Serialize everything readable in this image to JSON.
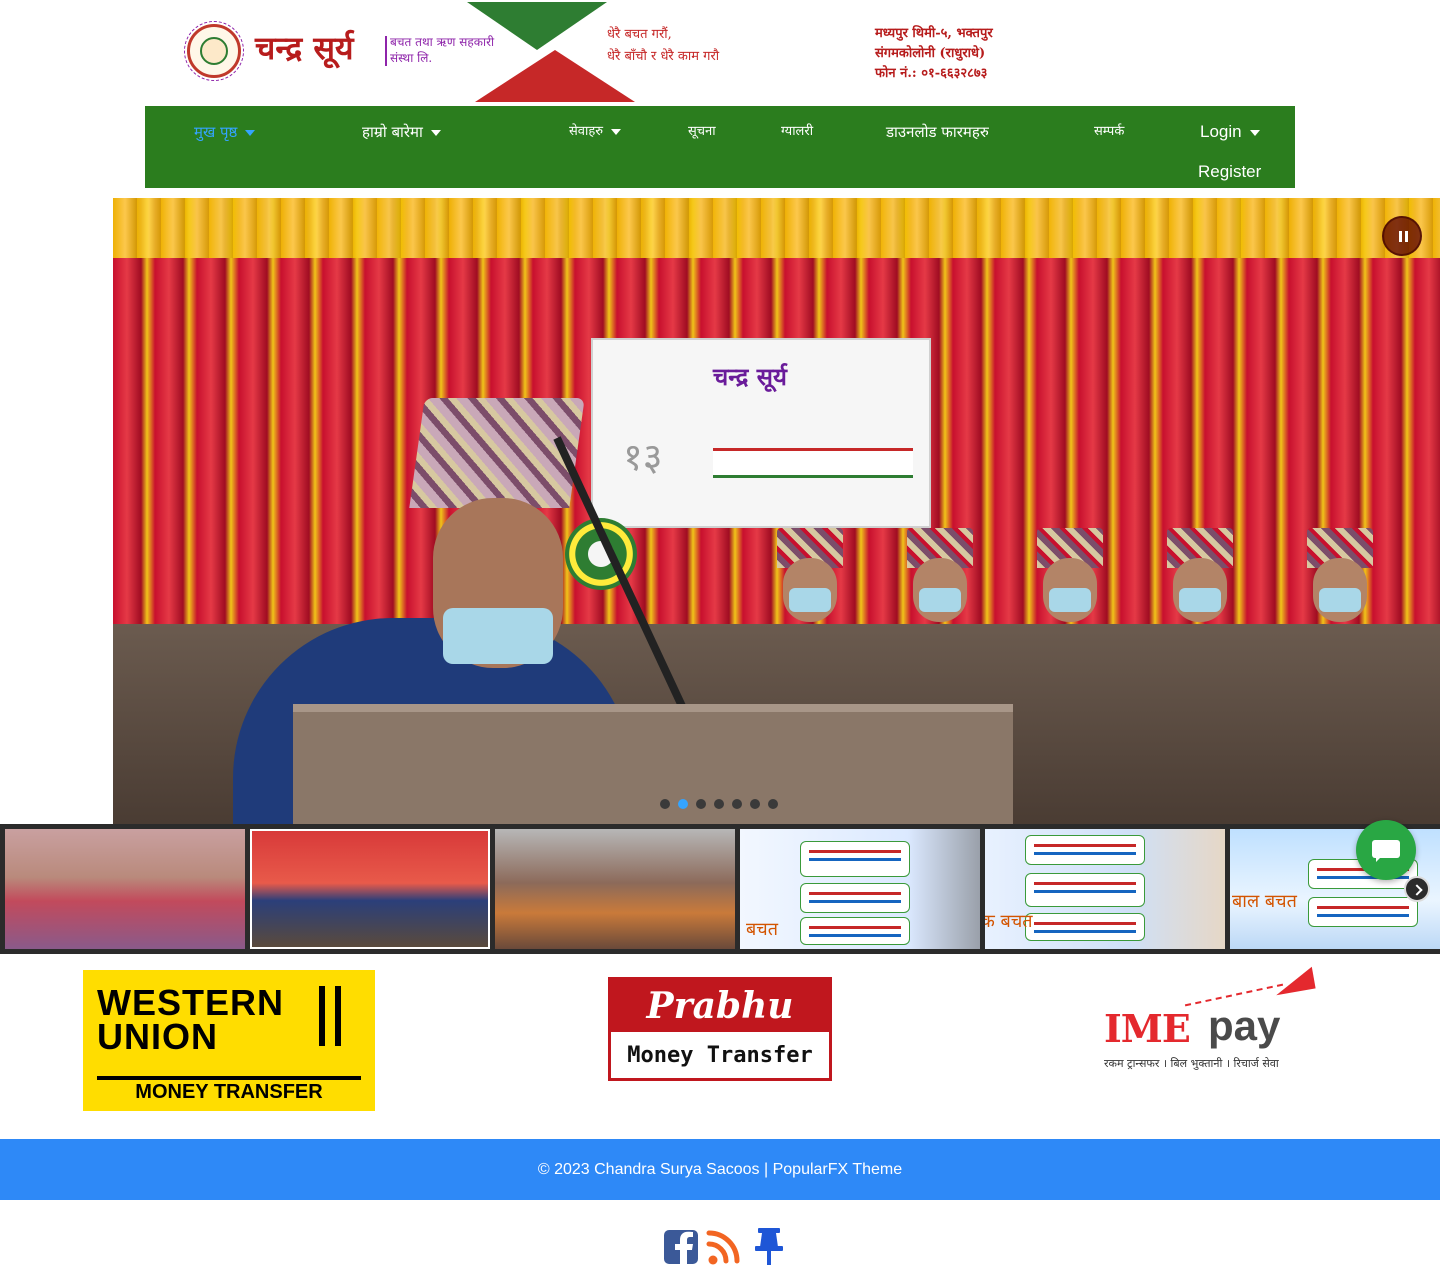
{
  "header": {
    "brand_name": "चन्द्र सूर्य",
    "brand_subtitle": "बचत तथा ऋण सहकारी संस्था लि.",
    "slogan_line1": "धेरै बचत गरौं,",
    "slogan_line2": "धेरै बाँचौ र धेरै काम गरौ",
    "address_line1": "मध्यपुर थिमी-५, भक्तपुर",
    "address_line2": "संगमकोलोनी (राधुराधे)",
    "phone_line": "फोन नं.: ०१-६६३२८७३"
  },
  "nav": {
    "items": [
      {
        "label": "मुख पृष्ठ",
        "active": true,
        "has_caret": true
      },
      {
        "label": "हाम्रो बारेमा",
        "active": false,
        "has_caret": true
      },
      {
        "label": "सेवाहरु",
        "active": false,
        "has_caret": true
      },
      {
        "label": "सूचना",
        "active": false,
        "has_caret": false
      },
      {
        "label": "ग्यालरी",
        "active": false,
        "has_caret": false
      },
      {
        "label": "डाउनलोड फारमहरु",
        "active": false,
        "has_caret": false
      },
      {
        "label": "सम्पर्क",
        "active": false,
        "has_caret": false
      }
    ],
    "login": "Login",
    "register": "Register",
    "bg_color": "#2b7d1e",
    "active_color": "#34a4ff"
  },
  "hero": {
    "banner_title": "चन्द्र सूर्य",
    "banner_number": "१३",
    "slide_count": 7,
    "active_slide": 2,
    "pause_icon": "pause-icon"
  },
  "thumbnails": {
    "count": 6,
    "active": 2,
    "thumb4_caption": "बचत",
    "thumb5_caption": "क बचत",
    "thumb6_caption": "बाल बचत"
  },
  "partners": {
    "western_union": {
      "line1": "WESTERN",
      "line2": "UNION",
      "bottom": "MONEY TRANSFER"
    },
    "prabhu": {
      "top": "Prabhu",
      "bottom": "Money Transfer"
    },
    "imepay": {
      "ime": "IME",
      "pay": "pay",
      "tagline": "रकम ट्रान्सफर । बिल भुक्तानी । रिचार्ज सेवा"
    }
  },
  "footer": {
    "copyright": "© 2023 Chandra Surya Sacoos",
    "separator": " | ",
    "theme_link": "PopularFX Theme",
    "bg_color": "#2e89f7"
  },
  "social": [
    {
      "icon": "facebook-icon",
      "color": "#3b5998"
    },
    {
      "icon": "rss-icon",
      "color": "#f26522"
    },
    {
      "icon": "pin-icon",
      "color": "#1e56d6"
    }
  ]
}
